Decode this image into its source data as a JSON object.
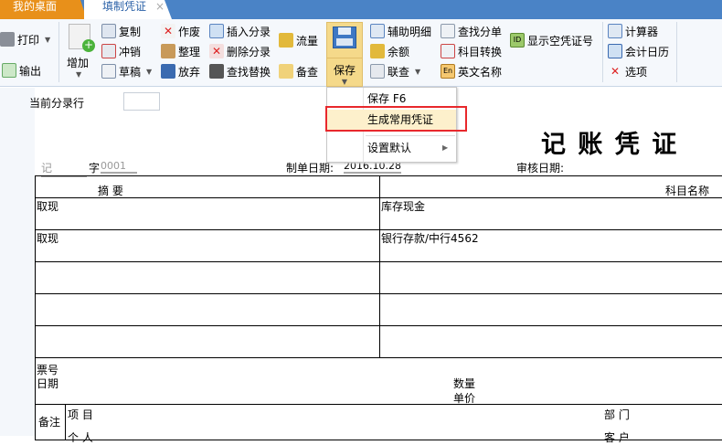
{
  "tabs": {
    "home": "我的桌面",
    "voucher": "填制凭证",
    "close": "×"
  },
  "toolbar": {
    "print": "打印",
    "export": "输出",
    "add": "增加",
    "copy": "复制",
    "reverse": "冲销",
    "draft": "草稿",
    "void": "作废",
    "organize": "整理",
    "abandon": "放弃",
    "insert_entry": "插入分录",
    "delete_entry": "删除分录",
    "find_replace": "查找替换",
    "flow": "流量",
    "backup_check": "备查",
    "save": "保存",
    "aux_detail": "辅助明细",
    "balance": "余额",
    "linked_query": "联查",
    "find_split": "查找分单",
    "account_convert": "科目转换",
    "english_name": "英文名称",
    "show_empty_no": "显示空凭证号",
    "calculator": "计算器",
    "accounting_calendar": "会计日历",
    "options": "选项"
  },
  "save_menu": {
    "items": [
      {
        "label": "保存 F6"
      },
      {
        "label": "生成常用凭证"
      },
      {
        "label": "设置默认"
      }
    ]
  },
  "form": {
    "current_entry_label": "当前分录行",
    "title": "记 账 凭 证",
    "voucher_type": "记",
    "zi": "字",
    "voucher_no": "0001",
    "date_label": "制单日期:",
    "date": "2016.10.28",
    "audit_label": "审核日期:"
  },
  "table": {
    "headers": [
      "摘 要",
      "科目名称"
    ],
    "rows": [
      [
        "取现",
        "库存现金"
      ],
      [
        "取现",
        "银行存款/中行4562"
      ],
      [
        "",
        ""
      ],
      [
        "",
        ""
      ],
      [
        "",
        ""
      ]
    ]
  },
  "bottom": {
    "ticket_no": "票号",
    "date": "日期",
    "quantity": "数量",
    "unit_price": "单价",
    "remark": "备注",
    "project": "项  目",
    "department": "部  门",
    "person": "个  人",
    "customer": "客  户"
  }
}
